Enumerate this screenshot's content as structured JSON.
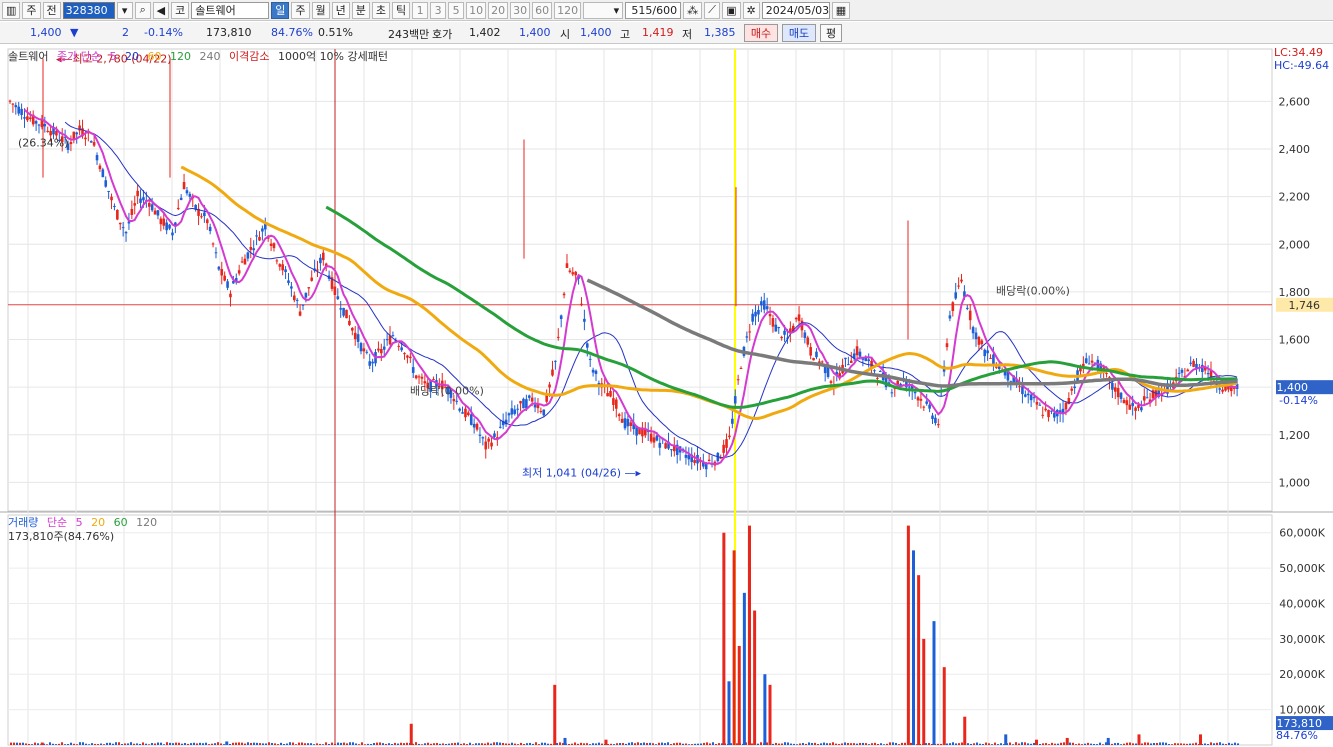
{
  "toolbar": {
    "type_label": "주",
    "prev_label": "전",
    "stock_code": "328380",
    "stock_name": "솔트웨어",
    "periods": [
      "일",
      "주",
      "월",
      "년",
      "분",
      "초",
      "틱"
    ],
    "minute_nums": [
      "1",
      "3",
      "5",
      "10",
      "20",
      "30",
      "60",
      "120"
    ],
    "count": "515/600",
    "date": "2024/05/03"
  },
  "quote": {
    "price": "1,400",
    "change": "2",
    "change_pct": "-0.14%",
    "volume": "173,810",
    "vol_ratio": "84.76%",
    "turnover": "0.51%",
    "amount": "243백만",
    "ask_label": "호가",
    "ask": "1,402",
    "bid": "1,400",
    "open_label": "시",
    "open": "1,400",
    "high_label": "고",
    "high": "1,419",
    "low_label": "저",
    "low": "1,385",
    "buy_label": "매수",
    "sell_label": "매도",
    "eval_label": "평"
  },
  "legend_price": {
    "name": "솔트웨어",
    "ma_label": "종가 단순",
    "ma_periods": [
      "5",
      "20",
      "60",
      "120",
      "240"
    ],
    "disparity": "이격감소",
    "pattern": "1000억 10% 강세패턴"
  },
  "legend_volume": {
    "title": "거래량",
    "ma_label": "단순",
    "ma_periods": [
      "5",
      "20",
      "60",
      "120"
    ],
    "summary": "173,810주(84.76%)"
  },
  "annotations": {
    "high": "최고 2,780 (04/22)",
    "high_change": "(26.34%)",
    "low": "최저 1,041 (04/26)",
    "dividend1": "배당락(0.00%)",
    "dividend2": "배당락(0.00%)",
    "lc": "LC:34.49",
    "hc": "HC:-49.64",
    "hline_value": "1,746",
    "last_price": "1,400",
    "last_pct": "-0.14%",
    "last_volume": "173,810",
    "last_vol_pct": "84.76%"
  },
  "colors": {
    "up": "#e8261c",
    "down": "#1c5fd6",
    "ma5": "#d43ad0",
    "ma20": "#2432c8",
    "ma60": "#f0aa10",
    "ma120": "#27a03a",
    "ma240": "#7a7a7a",
    "crosshair": "#ffff00",
    "hline": "#e84545"
  },
  "chart_data": [
    {
      "type": "candlestick",
      "title": "솔트웨어",
      "ylim": [
        880,
        2820
      ],
      "yticks": [
        1000,
        1200,
        1400,
        1600,
        1800,
        2000,
        2200,
        2400,
        2600
      ],
      "close_series": [
        2600,
        2560,
        2520,
        2500,
        2460,
        2420,
        2480,
        2450,
        2300,
        2150,
        2050,
        2200,
        2180,
        2100,
        2050,
        2250,
        2150,
        2100,
        1900,
        1800,
        1920,
        2000,
        2080,
        1950,
        1850,
        1720,
        1850,
        1950,
        1800,
        1700,
        1600,
        1500,
        1550,
        1620,
        1560,
        1450,
        1400,
        1420,
        1380,
        1300,
        1250,
        1150,
        1200,
        1280,
        1320,
        1350,
        1300,
        1500,
        1900,
        1850,
        1500,
        1400,
        1350,
        1250,
        1220,
        1200,
        1170,
        1150,
        1120,
        1100,
        1080,
        1100,
        1180,
        1500,
        1700,
        1750,
        1650,
        1600,
        1700,
        1550,
        1500,
        1420,
        1500,
        1550,
        1500,
        1450,
        1400,
        1430,
        1380,
        1320,
        1250,
        1700,
        1850,
        1650,
        1550,
        1500,
        1450,
        1400,
        1350,
        1300,
        1280,
        1320,
        1450,
        1520,
        1480,
        1400,
        1350,
        1300,
        1350,
        1380,
        1400,
        1450,
        1500,
        1480,
        1420,
        1390,
        1400
      ],
      "markers": {
        "high": {
          "value": 2780,
          "date": "04/22"
        },
        "low": {
          "value": 1041,
          "date": "04/26"
        }
      },
      "hline": 1746,
      "last": 1400
    },
    {
      "type": "bar",
      "title": "거래량",
      "ylim": [
        0,
        65000
      ],
      "yticks_labels": [
        "10,000K",
        "20,000K",
        "30,000K",
        "40,000K",
        "50,000K",
        "60,000K"
      ],
      "spikes": [
        [
          0.03,
          0.7
        ],
        [
          0.21,
          1.0
        ],
        [
          0.39,
          6
        ],
        [
          0.53,
          17
        ],
        [
          0.54,
          2
        ],
        [
          0.58,
          1.5
        ],
        [
          0.695,
          60
        ],
        [
          0.7,
          18
        ],
        [
          0.705,
          55
        ],
        [
          0.71,
          28
        ],
        [
          0.715,
          43
        ],
        [
          0.72,
          62
        ],
        [
          0.725,
          38
        ],
        [
          0.735,
          20
        ],
        [
          0.74,
          17
        ],
        [
          0.875,
          62
        ],
        [
          0.88,
          55
        ],
        [
          0.885,
          48
        ],
        [
          0.89,
          30
        ],
        [
          0.9,
          35
        ],
        [
          0.91,
          22
        ],
        [
          0.93,
          8
        ],
        [
          0.97,
          3
        ],
        [
          1.0,
          1.5
        ],
        [
          1.03,
          2
        ],
        [
          1.07,
          2
        ],
        [
          1.1,
          3
        ],
        [
          1.16,
          3
        ]
      ]
    }
  ]
}
